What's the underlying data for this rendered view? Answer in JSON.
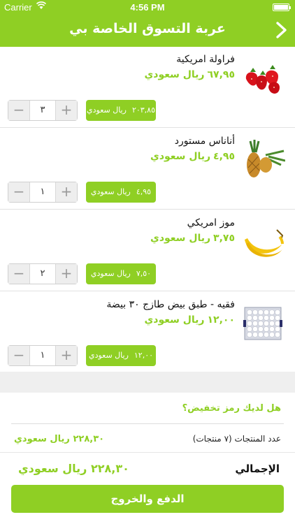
{
  "status": {
    "carrier": "Carrier",
    "time": "4:56 PM"
  },
  "nav": {
    "title": "عربة التسوق الخاصة بي",
    "back_icon": "chevron-right-icon"
  },
  "items": [
    {
      "name": "فراولة امريكية",
      "price": "٦٧,٩٥",
      "currency": "ريال سعودي",
      "line_total": "٢٠٣,٨٥",
      "qty": "٣",
      "image": "strawberry-image"
    },
    {
      "name": "أناناس مستورد",
      "price": "٤,٩٥",
      "currency": "ريال سعودي",
      "line_total": "٤,٩٥",
      "qty": "١",
      "image": "pineapple-image"
    },
    {
      "name": "موز امريكي",
      "price": "٣,٧٥",
      "currency": "ريال سعودي",
      "line_total": "٧,٥٠",
      "qty": "٢",
      "image": "banana-image"
    },
    {
      "name": "فقيه - طبق بيض طازج ٣٠ بيضة",
      "price": "١٢,٠٠",
      "currency": "ريال سعودي",
      "line_total": "١٢,٠٠",
      "qty": "١",
      "image": "eggs-image"
    }
  ],
  "stepper": {
    "minus": "−",
    "plus": "+"
  },
  "summary": {
    "promo": "هل لديك رمز تخفيض؟",
    "count_label": "عدد المنتجات (٧ منتجات)",
    "count_value": "٢٢٨,٣٠",
    "currency": "ريال سعودي",
    "total_label": "الإجمالي",
    "total_value": "٢٢٨,٣٠"
  },
  "checkout_label": "الدفع والخروج",
  "colors": {
    "accent": "#8fcf24",
    "separator": "#efefef"
  }
}
